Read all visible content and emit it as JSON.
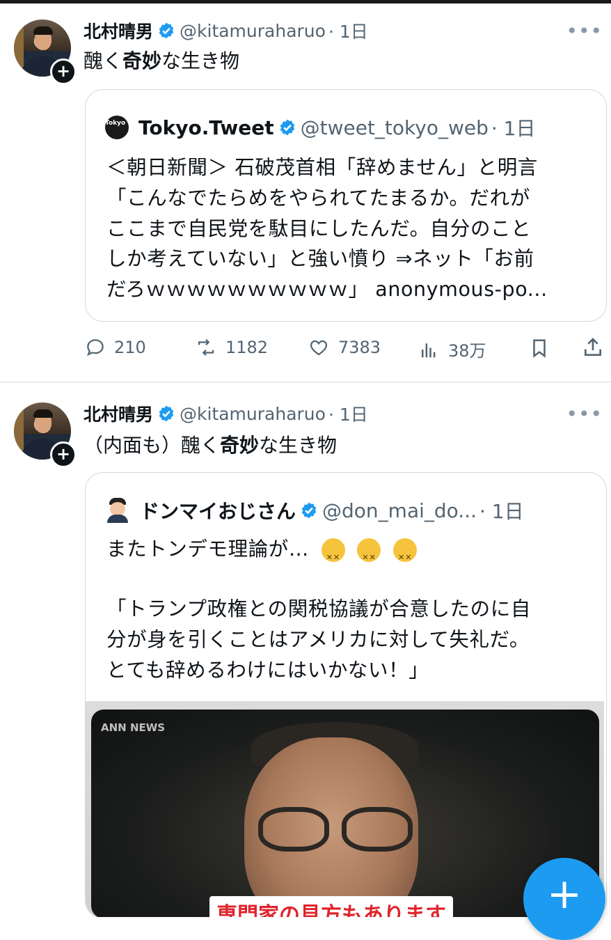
{
  "colors": {
    "verified_blue": "#1d9bf0",
    "handle_gray": "#536471",
    "caption_red": "#e0232b"
  },
  "posts": [
    {
      "author": {
        "name": "北村晴男",
        "handle": "@kitamuraharuo",
        "time": "· 1日"
      },
      "text_pre": "醜く",
      "text_bold": "奇妙",
      "text_post": "な生き物",
      "quote": {
        "logo_text": "Tokyo Tweet",
        "name": "Tokyo.Tweet",
        "handle": "@tweet_tokyo_web",
        "time": "· 1日",
        "lines": [
          "＜朝日新聞＞ 石破茂首相「辞めません」と明言",
          "「こんなでたらめをやられてたまるか。だれが",
          "ここまで自民党を駄目にしたんだ。自分のこと",
          "しか考えていない」と強い憤り ⇒ネット「お前",
          "だろｗｗｗｗｗｗｗｗｗｗ」 anonymous-po..."
        ]
      },
      "actions": {
        "replies": "210",
        "reposts": "1182",
        "likes": "7383",
        "views": "38万"
      }
    },
    {
      "author": {
        "name": "北村晴男",
        "handle": "@kitamuraharuo",
        "time": "· 1日"
      },
      "text_pre": "（内面も）醜く",
      "text_bold": "奇妙",
      "text_post": "な生き物",
      "quote": {
        "name": "ドンマイおじさん",
        "handle": "@don_mai_do...",
        "time": "· 1日",
        "line1": "またトンデモ理論が…",
        "lines": [
          "「トランプ政権との関税協議が合意したのに自",
          "分が身を引くことはアメリカに対して失礼だ。",
          "とても辞めるわけにはいかない！」"
        ],
        "media": {
          "news_tag": "ANN NEWS",
          "caption": "専門家の見方もあります"
        }
      }
    }
  ],
  "fab_label": "+"
}
